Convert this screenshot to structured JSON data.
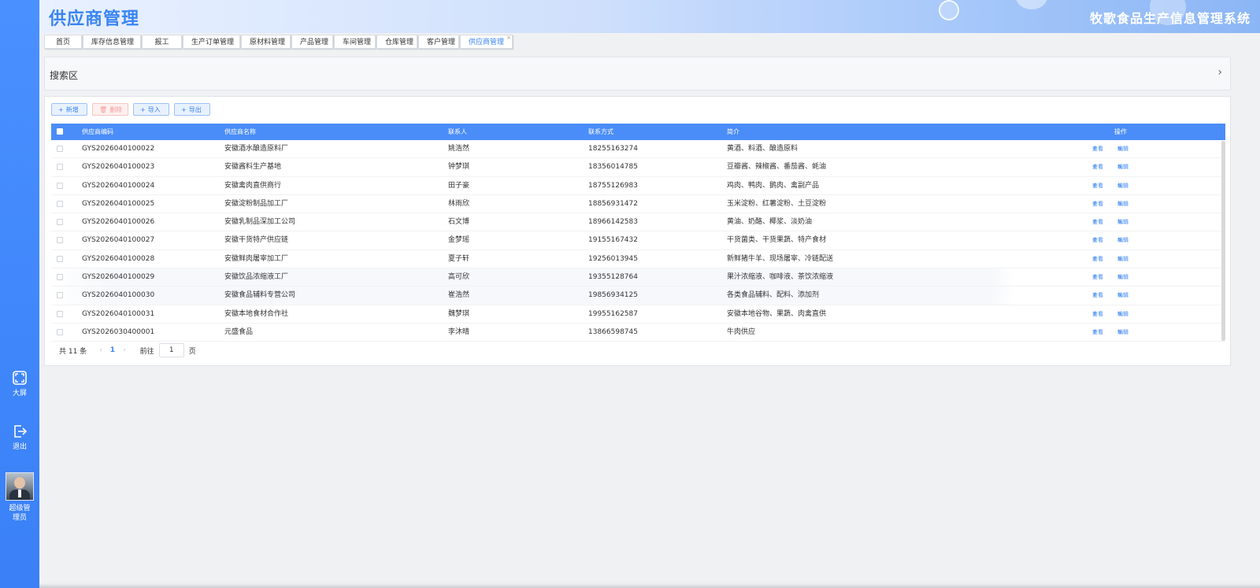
{
  "header": {
    "title": "供应商管理",
    "system_name": "牧歌食品生产信息管理系统"
  },
  "sidebar": {
    "fullscreen_label": "大屏",
    "logout_label": "退出",
    "user_label": "超级管理员"
  },
  "tabs": [
    {
      "label": "首页"
    },
    {
      "label": "库存信息管理"
    },
    {
      "label": "报工"
    },
    {
      "label": "生产订单管理"
    },
    {
      "label": "原材料管理"
    },
    {
      "label": "产品管理"
    },
    {
      "label": "车间管理"
    },
    {
      "label": "仓库管理"
    },
    {
      "label": "客户管理"
    },
    {
      "label": "供应商管理",
      "active": true
    }
  ],
  "search": {
    "label": "搜索区",
    "toggle_icon": "chevron-right-icon"
  },
  "toolbar": {
    "add_label": "新增",
    "delete_label": "删除",
    "import_label": "导入",
    "export_label": "导出"
  },
  "table": {
    "columns": [
      "供应商编码",
      "供应商名称",
      "联系人",
      "联系方式",
      "简介",
      "操作"
    ],
    "view_label": "查看",
    "edit_label": "编辑",
    "rows": [
      {
        "code": "GYS2026040100022",
        "name": "安徽酒水酿造原料厂",
        "contact": "姚浩然",
        "phone": "18255163274",
        "intro": "黄酒、料酒、酿造原料"
      },
      {
        "code": "GYS2026040100023",
        "name": "安徽酱料生产基地",
        "contact": "钟梦琪",
        "phone": "18356014785",
        "intro": "豆瓣酱、辣椒酱、番茄酱、蚝油"
      },
      {
        "code": "GYS2026040100024",
        "name": "安徽禽肉直供商行",
        "contact": "田子豪",
        "phone": "18755126983",
        "intro": "鸡肉、鸭肉、鹅肉、禽副产品"
      },
      {
        "code": "GYS2026040100025",
        "name": "安徽淀粉制品加工厂",
        "contact": "林雨欣",
        "phone": "18856931472",
        "intro": "玉米淀粉、红薯淀粉、土豆淀粉"
      },
      {
        "code": "GYS2026040100026",
        "name": "安徽乳制品深加工公司",
        "contact": "石文博",
        "phone": "18966142583",
        "intro": "黄油、奶酪、椰浆、淡奶油"
      },
      {
        "code": "GYS2026040100027",
        "name": "安徽干货特产供应链",
        "contact": "金梦瑶",
        "phone": "19155167432",
        "intro": "干货菌类、干货果蔬、特产食材"
      },
      {
        "code": "GYS2026040100028",
        "name": "安徽鲜肉屠宰加工厂",
        "contact": "夏子轩",
        "phone": "19256013945",
        "intro": "新鲜猪牛羊、现场屠宰、冷链配送"
      },
      {
        "code": "GYS2026040100029",
        "name": "安徽饮品浓缩液工厂",
        "contact": "高可欣",
        "phone": "19355128764",
        "intro": "果汁浓缩液、咖啡液、茶饮浓缩液"
      },
      {
        "code": "GYS2026040100030",
        "name": "安徽食品辅料专营公司",
        "contact": "崔浩然",
        "phone": "19856934125",
        "intro": "各类食品辅料、配料、添加剂"
      },
      {
        "code": "GYS2026040100031",
        "name": "安徽本地食材合作社",
        "contact": "魏梦琪",
        "phone": "19955162587",
        "intro": "安徽本地谷物、果蔬、肉禽直供"
      },
      {
        "code": "GYS2026030400001",
        "name": "元盛食品",
        "contact": "李沐晴",
        "phone": "13866598745",
        "intro": "牛肉供应"
      }
    ]
  },
  "pagination": {
    "total_text": "共 11 条",
    "current_page": "1",
    "goto_label": "前往",
    "goto_value": "1",
    "page_unit": "页"
  },
  "colors": {
    "primary": "#4a8df8",
    "accent_text": "#3a85f2",
    "danger": "#f59a9a"
  }
}
